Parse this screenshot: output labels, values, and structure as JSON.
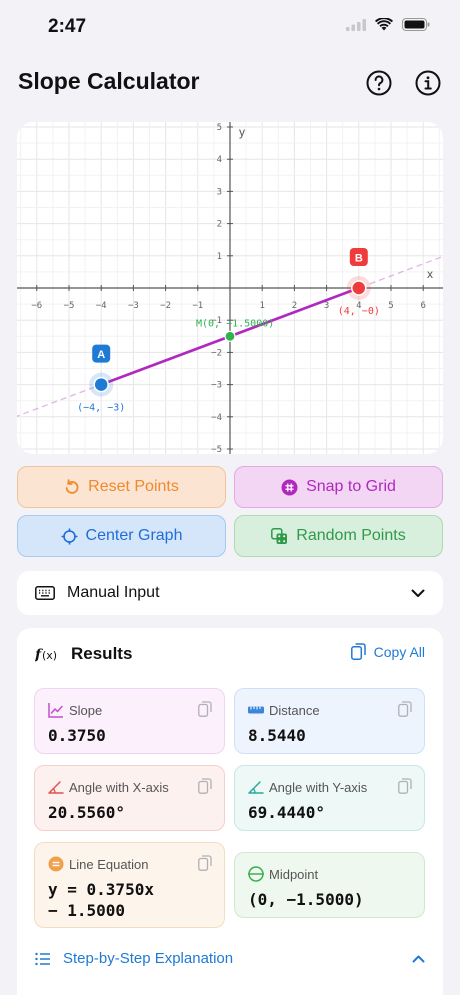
{
  "status": {
    "time": "2:47"
  },
  "header": {
    "title": "Slope Calculator",
    "help_icon": "question-circle-icon",
    "info_icon": "info-circle-icon"
  },
  "graph": {
    "x_axis_label": "x",
    "y_axis_label": "y",
    "x_ticks": [
      "−6",
      "−5",
      "−4",
      "−3",
      "−2",
      "−1",
      "1",
      "2",
      "3",
      "4",
      "5",
      "6"
    ],
    "y_ticks": [
      "5",
      "4",
      "3",
      "2",
      "1",
      "−1",
      "−2",
      "−3",
      "−4",
      "−5"
    ],
    "point_a": {
      "label": "A",
      "coords": "(−4, −3)",
      "x": -4,
      "y": -3,
      "color": "#1f7ad6"
    },
    "point_b": {
      "label": "B",
      "coords": "(4, −0)",
      "x": 4,
      "y": 0,
      "color": "#ef3b3b"
    },
    "midpoint": {
      "label": "M(0, −1.5000)",
      "x": 0,
      "y": -1.5,
      "color": "#2fb34a"
    },
    "line_color": "#b128c1",
    "x_range": [
      -6,
      6
    ],
    "y_range": [
      -5,
      5
    ],
    "grid": true
  },
  "buttons": {
    "reset": "Reset Points",
    "snap": "Snap to Grid",
    "center": "Center Graph",
    "random": "Random Points"
  },
  "manual_input": {
    "label": "Manual Input"
  },
  "results": {
    "title": "Results",
    "copy_all": "Copy All",
    "slope": {
      "label": "Slope",
      "value": "0.3750"
    },
    "distance": {
      "label": "Distance",
      "value": "8.5440"
    },
    "angle_x": {
      "label": "Angle with X-axis",
      "value": "20.5560°"
    },
    "angle_y": {
      "label": "Angle with Y-axis",
      "value": "69.4440°"
    },
    "equation": {
      "label": "Line Equation",
      "value_line1": "y = 0.3750x",
      "value_line2": "− 1.5000"
    },
    "midpoint": {
      "label": "Midpoint",
      "value": "(0, −1.5000)"
    },
    "steps": {
      "label": "Step-by-Step Explanation"
    }
  },
  "colors": {
    "accent_blue": "#1f7ad6",
    "orange": "#f08a2c",
    "purple": "#b128c1",
    "green": "#2f9a4a"
  }
}
